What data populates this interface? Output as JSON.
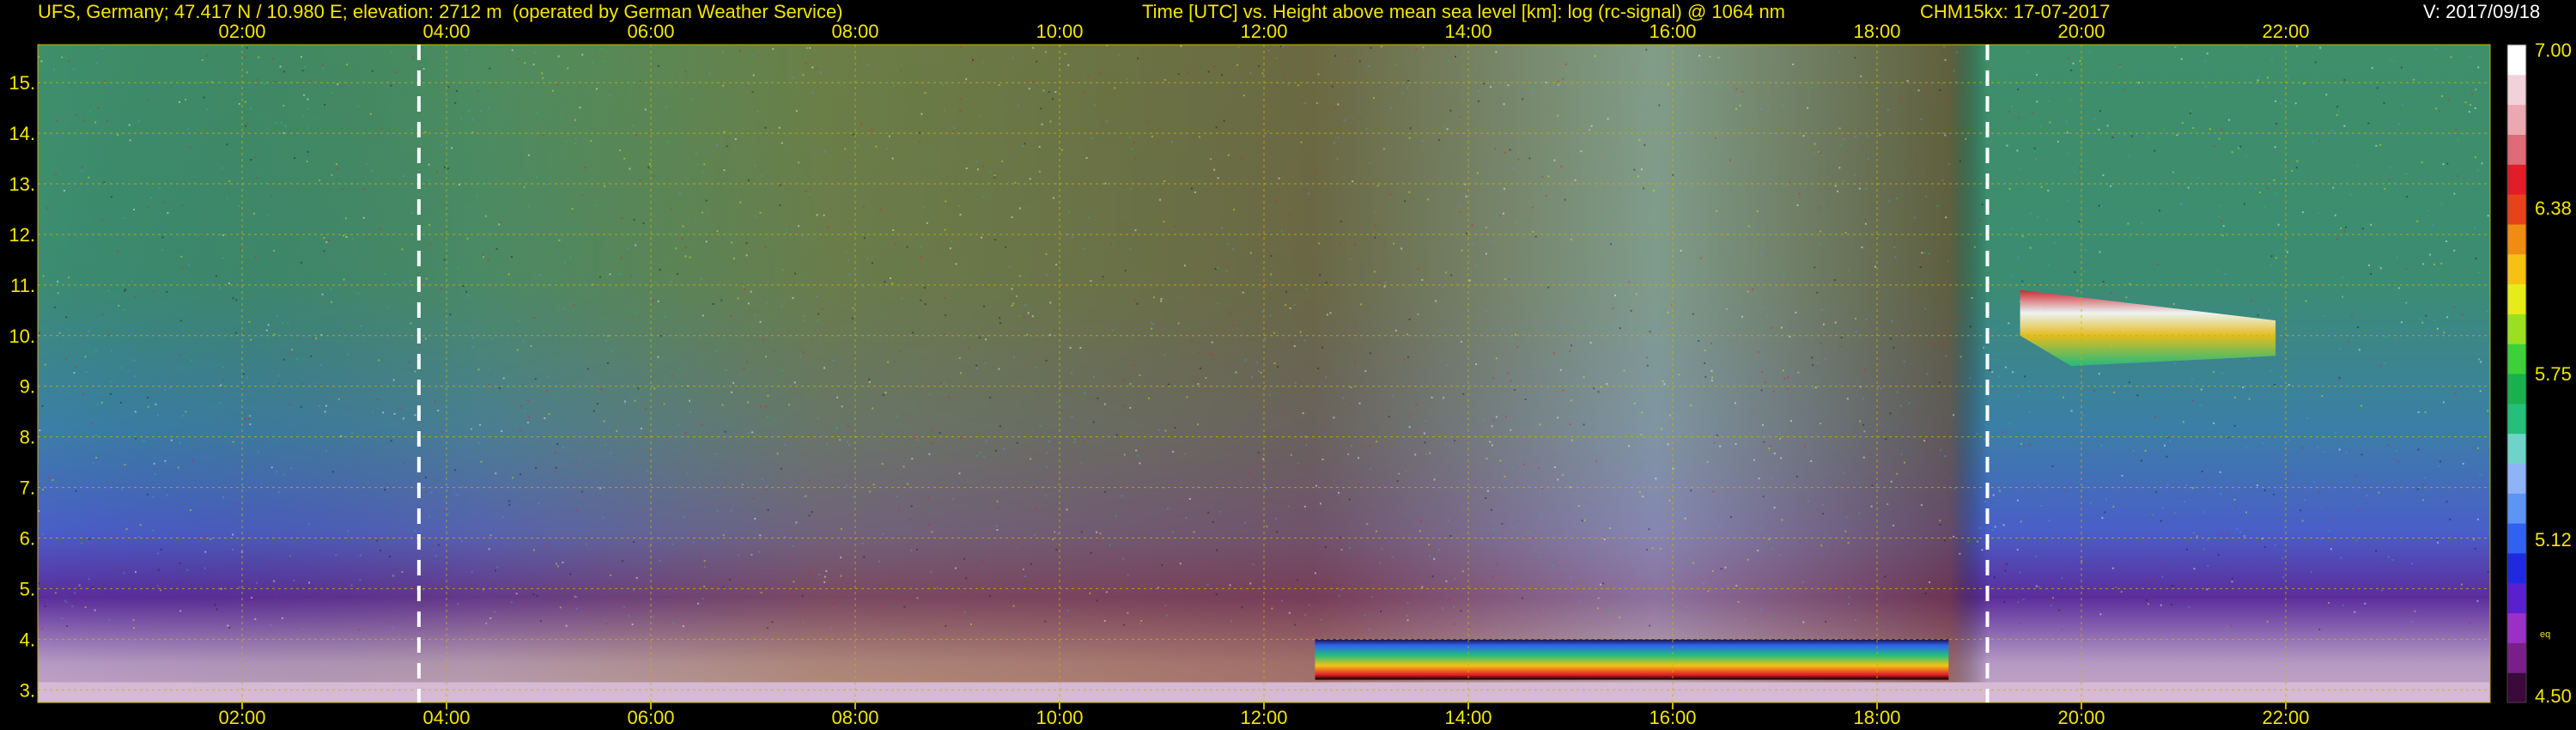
{
  "header": {
    "station": "UFS, Germany; 47.417 N / 10.980 E; elevation: 2712 m  (operated by German Weather Service)",
    "plot_desc": "Time [UTC] vs. Height above mean sea level [km]: log (rc-signal) @ 1064 nm",
    "instrument_date": "CHM15kx: 17-07-2017",
    "version": "V: 2017/09/18"
  },
  "chart_data": {
    "type": "heatmap",
    "title": "Time [UTC] vs. Height above mean sea level [km]: log (rc-signal) @ 1064 nm",
    "x_range_hours": [
      0.0,
      24.0
    ],
    "y_range_km": [
      2.75,
      15.75
    ],
    "x_ticks": [
      {
        "value": 2,
        "label": "02:00"
      },
      {
        "value": 4,
        "label": "04:00"
      },
      {
        "value": 6,
        "label": "06:00"
      },
      {
        "value": 8,
        "label": "08:00"
      },
      {
        "value": 10,
        "label": "10:00"
      },
      {
        "value": 12,
        "label": "12:00"
      },
      {
        "value": 14,
        "label": "14:00"
      },
      {
        "value": 16,
        "label": "16:00"
      },
      {
        "value": 18,
        "label": "18:00"
      },
      {
        "value": 20,
        "label": "20:00"
      },
      {
        "value": 22,
        "label": "22:00"
      }
    ],
    "y_ticks": [
      {
        "value": 3,
        "label": "3."
      },
      {
        "value": 4,
        "label": "4."
      },
      {
        "value": 5,
        "label": "5."
      },
      {
        "value": 6,
        "label": "6."
      },
      {
        "value": 7,
        "label": "7."
      },
      {
        "value": 8,
        "label": "8."
      },
      {
        "value": 9,
        "label": "9."
      },
      {
        "value": 10,
        "label": "10."
      },
      {
        "value": 11,
        "label": "11."
      },
      {
        "value": 12,
        "label": "12."
      },
      {
        "value": 13,
        "label": "13."
      },
      {
        "value": 14,
        "label": "14."
      },
      {
        "value": 15,
        "label": "15."
      }
    ],
    "grid": true,
    "dashed_markers_hours": [
      3.73,
      19.08
    ],
    "colorbar": {
      "min": 4.5,
      "max": 7.0,
      "tick_labels": [
        {
          "value": 4.5,
          "label": "4.50"
        },
        {
          "value": 5.12,
          "label": "5.12"
        },
        {
          "value": 5.75,
          "label": "5.75"
        },
        {
          "value": 6.38,
          "label": "6.38"
        },
        {
          "value": 7.0,
          "label": "7.00"
        }
      ],
      "unit": "eq",
      "colors": [
        "#3a0a3a",
        "#7a1f8a",
        "#9b30c8",
        "#5a1fd0",
        "#1f2ae0",
        "#2f62f0",
        "#5c95f5",
        "#8fb3f4",
        "#6fd4c8",
        "#22c07a",
        "#19b050",
        "#3cd03a",
        "#9be020",
        "#e6ec18",
        "#f5c214",
        "#f08c10",
        "#e8421c",
        "#e01d28",
        "#e06a78",
        "#eaa8b0",
        "#f2d2da",
        "#ffffff"
      ]
    },
    "features": [
      {
        "name": "aerosol",
        "start_h": 12.5,
        "end_h": 18.7,
        "base_km": 3.2,
        "top_km": 4.0
      },
      {
        "name": "cloud",
        "start_h": 19.4,
        "end_h": 21.9,
        "base_km": 9.4,
        "top_km": 10.9
      }
    ],
    "colors": {
      "text": "#f2e600",
      "grid": "#c8b400",
      "marker": "#ffffff"
    }
  }
}
